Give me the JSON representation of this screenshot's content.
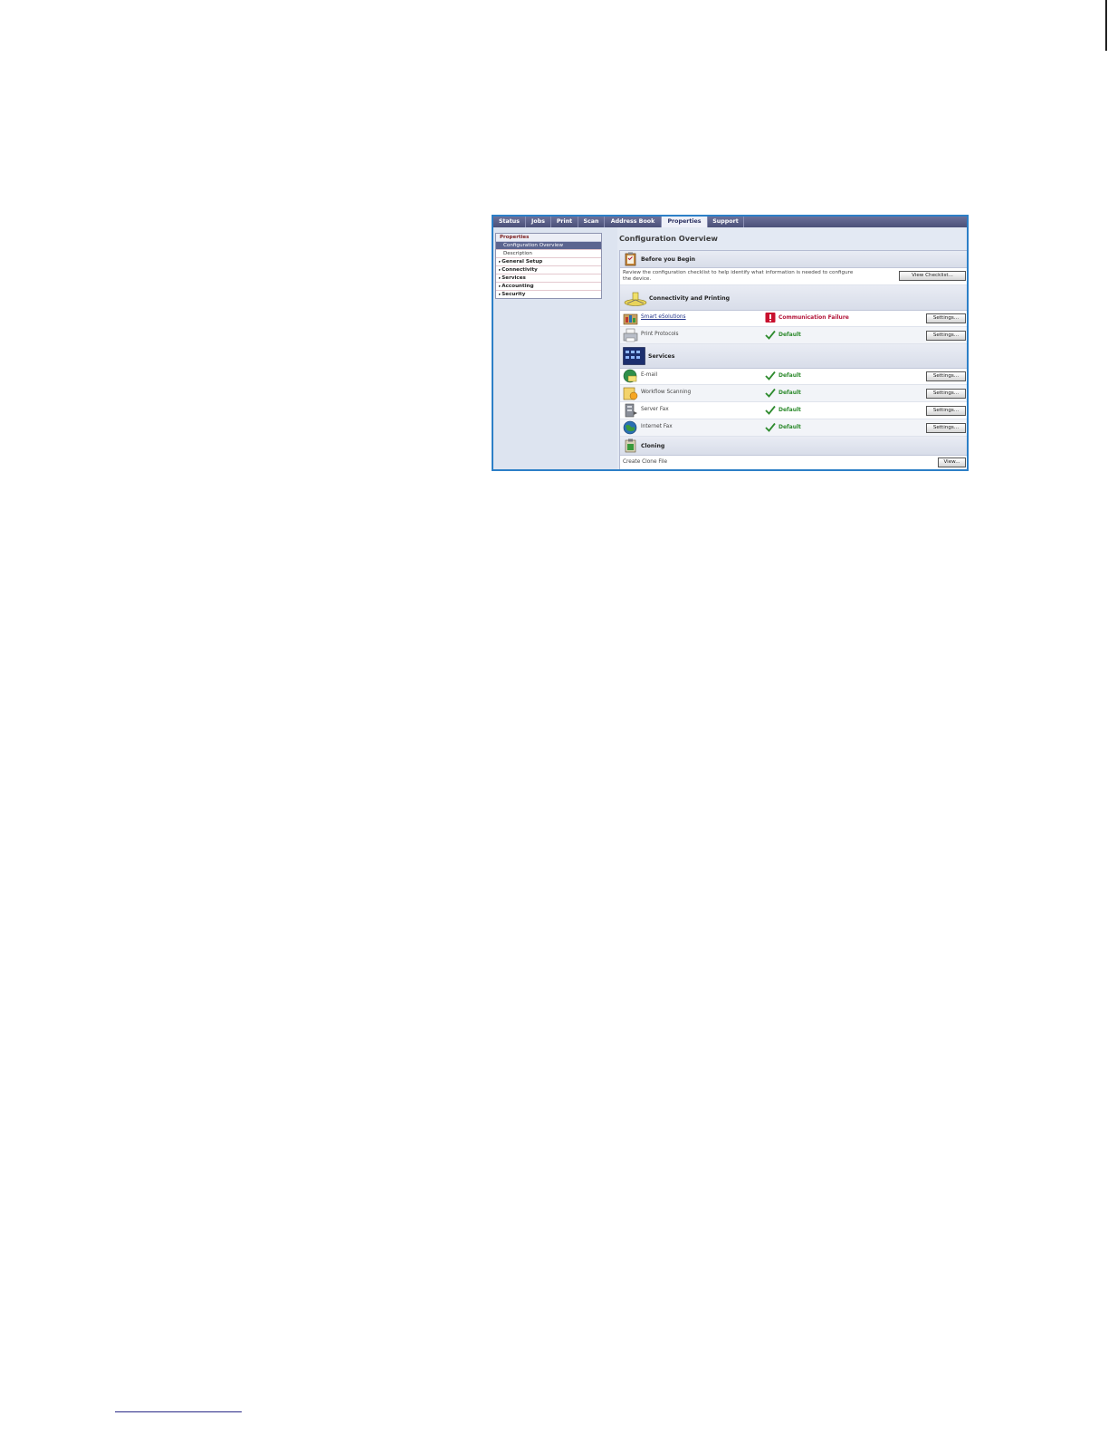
{
  "tabs": [
    {
      "label": "Status"
    },
    {
      "label": "Jobs"
    },
    {
      "label": "Print"
    },
    {
      "label": "Scan"
    },
    {
      "label": "Address Book"
    },
    {
      "label": "Properties"
    },
    {
      "label": "Support"
    }
  ],
  "active_tab": "Properties",
  "sidebar": {
    "heading": "Properties",
    "items": [
      {
        "label": "Configuration Overview"
      },
      {
        "label": "Description"
      }
    ],
    "sections": [
      {
        "label": "General Setup"
      },
      {
        "label": "Connectivity"
      },
      {
        "label": "Services"
      },
      {
        "label": "Accounting"
      },
      {
        "label": "Security"
      }
    ]
  },
  "main": {
    "title": "Configuration Overview",
    "before": {
      "heading": "Before you Begin",
      "text_line1": "Review the configuration checklist to help identify what information is needed to configure",
      "text_line2": "the device.",
      "button": "View Checklist..."
    },
    "connectivity": {
      "heading": "Connectivity and Printing",
      "rows": [
        {
          "label": "Smart eSolutions",
          "status": "Communication Failure",
          "button": "Settings..."
        },
        {
          "label": "Print Protocols",
          "status": "Default",
          "button": "Settings..."
        }
      ]
    },
    "services": {
      "heading": "Services",
      "rows": [
        {
          "label": "E-mail",
          "status": "Default",
          "button": "Settings..."
        },
        {
          "label": "Workflow Scanning",
          "status": "Default",
          "button": "Settings..."
        },
        {
          "label": "Server Fax",
          "status": "Default",
          "button": "Settings..."
        },
        {
          "label": "Internet Fax",
          "status": "Default",
          "button": "Settings..."
        }
      ]
    },
    "cloning": {
      "heading": "Cloning",
      "label": "Create Clone File",
      "button": "View..."
    }
  },
  "colors": {
    "tabbar": "#5b6088",
    "frame_border": "#2c7fc7",
    "status_ok": "#2e8b2e",
    "status_error": "#b3163a",
    "nav_selected": "#5c6590"
  }
}
